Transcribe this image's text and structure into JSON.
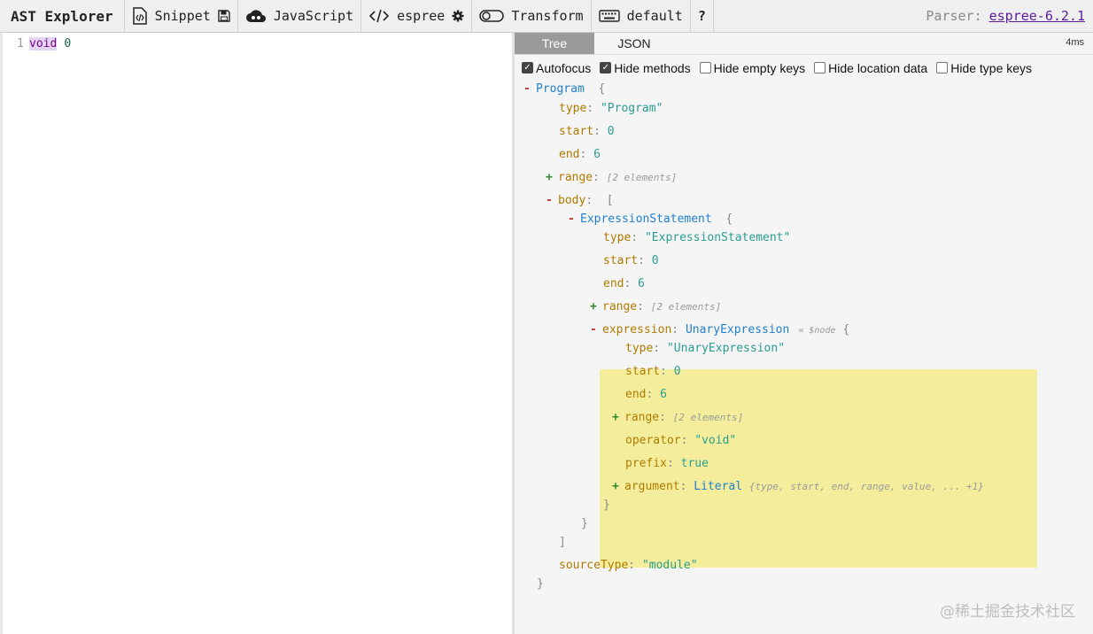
{
  "toolbar": {
    "title": "AST Explorer",
    "snippet_label": "Snippet",
    "language_label": "JavaScript",
    "parser_button_label": "espree",
    "transform_label": "Transform",
    "keymap_label": "default",
    "help_label": "?",
    "parser_prefix": "Parser:",
    "parser_version": "espree-6.2.1"
  },
  "editor": {
    "line_number": "1",
    "keyword": "void",
    "number": "0"
  },
  "output": {
    "tabs": [
      "Tree",
      "JSON"
    ],
    "timing": "4ms",
    "options": [
      {
        "label": "Autofocus",
        "checked": true
      },
      {
        "label": "Hide methods",
        "checked": true
      },
      {
        "label": "Hide empty keys",
        "checked": false
      },
      {
        "label": "Hide location data",
        "checked": false
      },
      {
        "label": "Hide type keys",
        "checked": false
      }
    ]
  },
  "tree": {
    "program_type": "Program",
    "open_brace": "{",
    "close_brace": "}",
    "open_bracket": "[",
    "close_bracket": "]",
    "colon": ":",
    "k_type": "type",
    "k_start": "start",
    "k_end": "end",
    "k_range": "range",
    "k_body": "body",
    "k_expression": "expression",
    "k_operator": "operator",
    "k_prefix": "prefix",
    "k_argument": "argument",
    "k_sourceType": "sourceType",
    "program_type_value": "\"Program\"",
    "program_start": "0",
    "program_end": "6",
    "range_summary": "[2 elements]",
    "expr_stmt_type": "ExpressionStatement",
    "expr_stmt_type_value": "\"ExpressionStatement\"",
    "expr_stmt_start": "0",
    "expr_stmt_end": "6",
    "unary_type": "UnaryExpression",
    "node_ref": "= $node",
    "unary_type_value": "\"UnaryExpression\"",
    "unary_start": "0",
    "unary_end": "6",
    "operator_value": "\"void\"",
    "prefix_value": "true",
    "argument_type": "Literal",
    "argument_summary": "{type, start, end, range, value, ... +1}",
    "source_type_value": "\"module\""
  },
  "watermark": "@稀土掘金技术社区",
  "colors": {
    "highlight": "#f4ee9c",
    "key": "#b07b00",
    "type": "#1f7fcf",
    "value": "#2a9d8f",
    "collapse": "#c0392b",
    "expand": "#2d8a2d"
  }
}
